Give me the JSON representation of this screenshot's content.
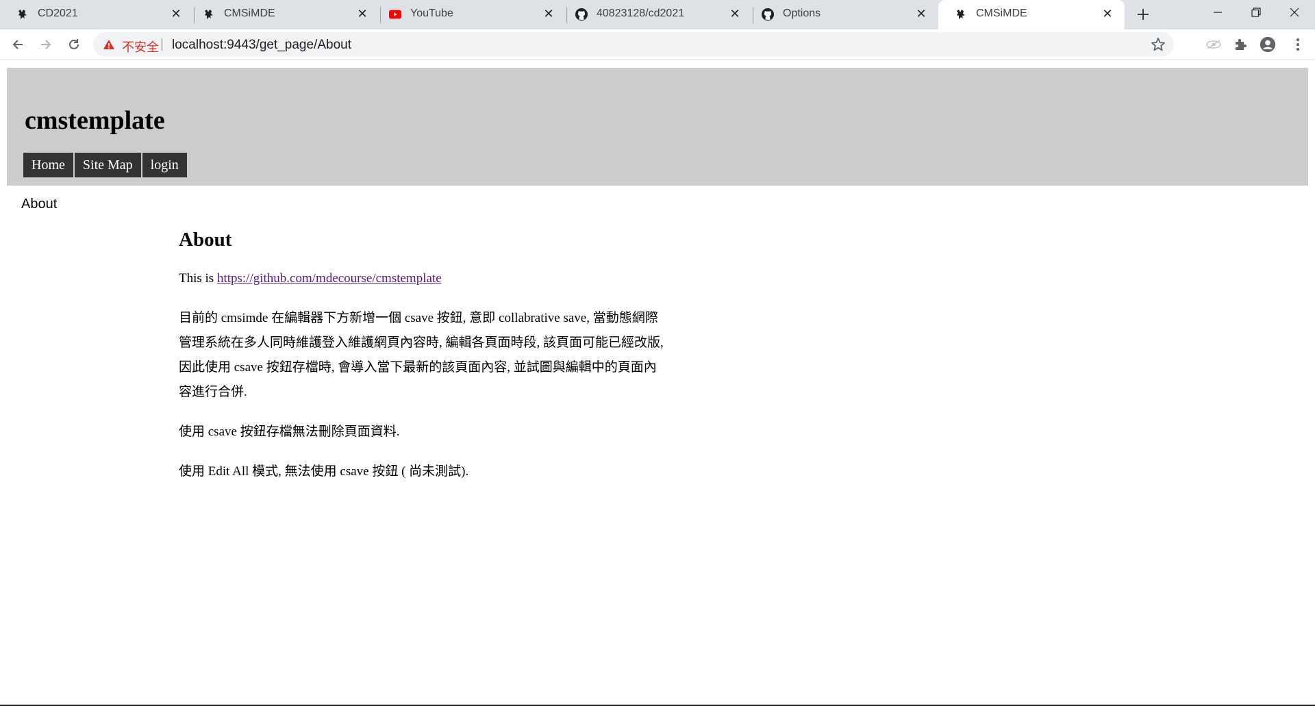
{
  "browser": {
    "tabs": [
      {
        "title": "CD2021",
        "icon": "cmsimde-favicon",
        "active": false
      },
      {
        "title": "CMSiMDE",
        "icon": "cmsimde-favicon",
        "active": false
      },
      {
        "title": "YouTube",
        "icon": "youtube-favicon",
        "active": false
      },
      {
        "title": "40823128/cd2021",
        "icon": "github-favicon",
        "active": false
      },
      {
        "title": "Options",
        "icon": "github-favicon",
        "active": false
      },
      {
        "title": "CMSiMDE",
        "icon": "cmsimde-favicon",
        "active": true
      }
    ],
    "security_label": "不安全",
    "url": "localhost:9443/get_page/About"
  },
  "site": {
    "title": "cmstemplate",
    "nav": [
      {
        "label": "Home"
      },
      {
        "label": "Site Map"
      },
      {
        "label": "login"
      }
    ],
    "sidebar_item": "About"
  },
  "content": {
    "heading": "About",
    "intro_prefix": "This is ",
    "intro_link": "https://github.com/mdecourse/cmstemplate",
    "paragraph_1_line_1": "目前的 cmsimde 在編輯器下方新增一個 csave 按鈕, 意即 collabrative save, 當動態網際",
    "paragraph_1_line_2": "管理系統在多人同時維護登入維護網頁內容時, 編輯各頁面時段, 該頁面可能已經改版,",
    "paragraph_1_line_3": "因此使用 csave 按鈕存檔時, 會導入當下最新的該頁面內容, 並試圖與編輯中的頁面內",
    "paragraph_1_line_4": "容進行合併.",
    "paragraph_2": "使用 csave 按鈕存檔無法刪除頁面資料.",
    "paragraph_3": "使用 Edit All 模式, 無法使用 csave 按鈕 ( 尚未測試)."
  }
}
